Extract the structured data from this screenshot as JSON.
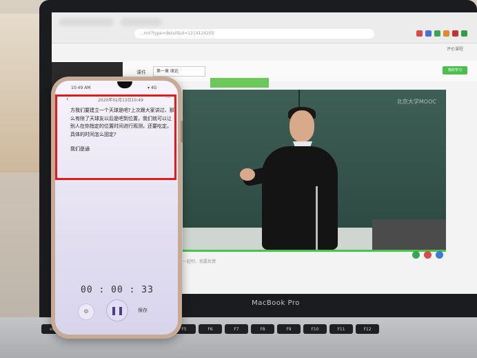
{
  "laptop": {
    "brand": "MacBook Pro",
    "browser": {
      "address_fragment": "...rmi?type=detail&id=1214124205",
      "top_right_link": "评价课程"
    },
    "course": {
      "crumb_prefix": "课件",
      "chapter_select": "第一章 绪论",
      "green_button": "我的学习",
      "below_video_text": "一起吧、我要反馈",
      "watermark": "北京大学MOOC"
    },
    "keyboard": {
      "row1": [
        "esc",
        "F1",
        "F2",
        "F3",
        "F4",
        "F5",
        "F6",
        "F7",
        "F8",
        "F9",
        "F10",
        "F11",
        "F12"
      ]
    }
  },
  "phone": {
    "status_time": "10:49 AM",
    "status_right": "▾ 4G",
    "recording_timestamp": "2020年02月13日10:49",
    "transcript": {
      "paragraph1": "方我们要建立一个天球是吧?上次跟大家讲过、那么有除了天球友以后是吧到位置，我们就可以让别人在你指定的位置时间进行观测，还要吃定。具体的时间怎么固定?",
      "paragraph2": "我们是通"
    },
    "timer": "00 : 00 : 33",
    "buttons": {
      "lang": "中",
      "pause": "❚❚",
      "save": "保存"
    }
  },
  "colors": {
    "highlight_box": "#e01b1b",
    "accent_green": "#4cbf50"
  }
}
